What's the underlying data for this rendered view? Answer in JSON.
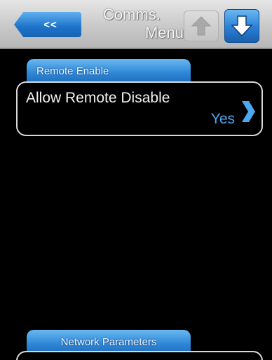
{
  "header": {
    "back_label": "<<",
    "title_line1": "Comms.",
    "title_line2": "Menu"
  },
  "groups": [
    {
      "label": "Remote Enable",
      "items": [
        {
          "label": "Allow Remote Disable",
          "value": "Yes"
        }
      ]
    },
    {
      "label": "Network Parameters"
    }
  ],
  "colors": {
    "accent_blue": "#2f86d6",
    "value_blue": "#4aa8ee",
    "header_gray": "#c9c9c9",
    "background": "#000000"
  },
  "icons": {
    "back": "double-chevron-left-icon",
    "up": "arrow-up-icon",
    "down": "arrow-down-icon",
    "item_arrow": "chevron-right-icon"
  }
}
